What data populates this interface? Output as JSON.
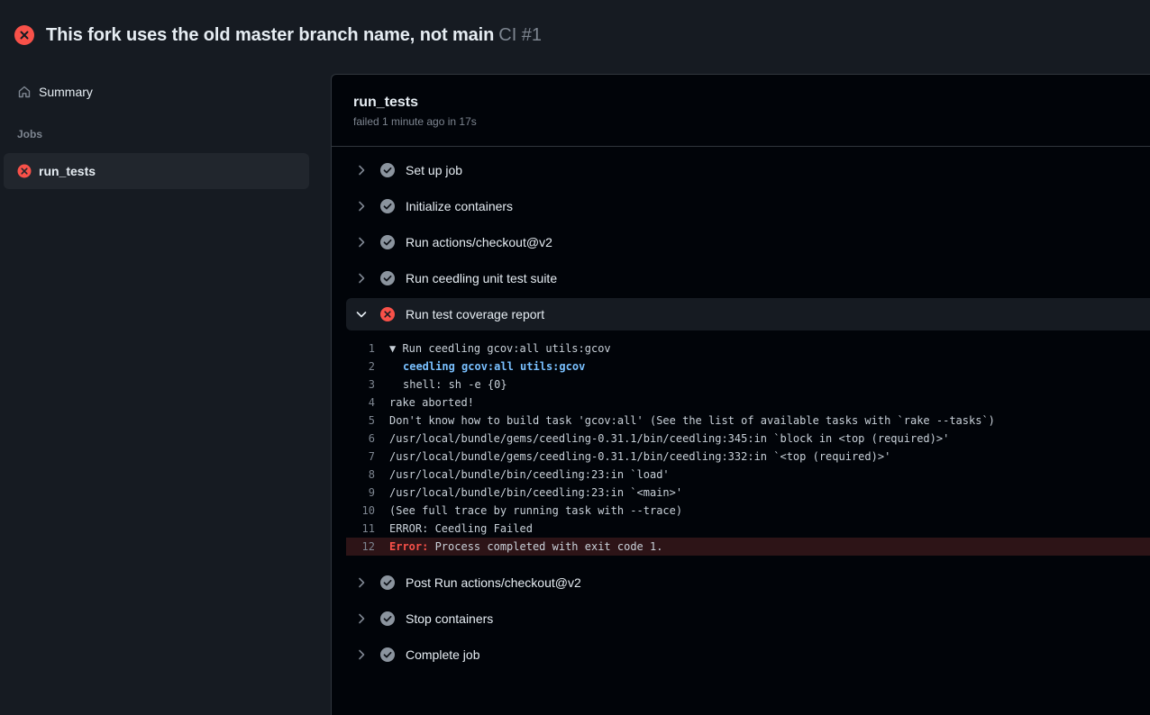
{
  "header": {
    "title": "This fork uses the old master branch name, not main",
    "workflow": "CI #1"
  },
  "sidebar": {
    "summary_label": "Summary",
    "jobs_heading": "Jobs",
    "jobs": [
      {
        "label": "run_tests",
        "status": "failed"
      }
    ]
  },
  "job": {
    "name": "run_tests",
    "subtitle": "failed 1 minute ago in 17s"
  },
  "steps_before": [
    {
      "label": "Set up job",
      "status": "success"
    },
    {
      "label": "Initialize containers",
      "status": "success"
    },
    {
      "label": "Run actions/checkout@v2",
      "status": "success"
    },
    {
      "label": "Run ceedling unit test suite",
      "status": "success"
    }
  ],
  "expanded_step": {
    "label": "Run test coverage report",
    "status": "failed",
    "log": [
      {
        "n": "1",
        "text": "▼ Run ceedling gcov:all utils:gcov"
      },
      {
        "n": "2",
        "text": "ceedling gcov:all utils:gcov"
      },
      {
        "n": "3",
        "text": "shell: sh -e {0}"
      },
      {
        "n": "4",
        "text": "rake aborted!"
      },
      {
        "n": "5",
        "text": "Don't know how to build task 'gcov:all' (See the list of available tasks with `rake --tasks`)"
      },
      {
        "n": "6",
        "text": "/usr/local/bundle/gems/ceedling-0.31.1/bin/ceedling:345:in `block in <top (required)>'"
      },
      {
        "n": "7",
        "text": "/usr/local/bundle/gems/ceedling-0.31.1/bin/ceedling:332:in `<top (required)>'"
      },
      {
        "n": "8",
        "text": "/usr/local/bundle/bin/ceedling:23:in `load'"
      },
      {
        "n": "9",
        "text": "/usr/local/bundle/bin/ceedling:23:in `<main>'"
      },
      {
        "n": "10",
        "text": "(See full trace by running task with --trace)"
      },
      {
        "n": "11",
        "text": "ERROR: Ceedling Failed"
      },
      {
        "n": "12",
        "err_label": "Error:",
        "text": " Process completed with exit code 1."
      }
    ]
  },
  "steps_after": [
    {
      "label": "Post Run actions/checkout@v2",
      "status": "success"
    },
    {
      "label": "Stop containers",
      "status": "success"
    },
    {
      "label": "Complete job",
      "status": "success"
    }
  ],
  "colors": {
    "failed": "#f85149",
    "success_icon": "#8b949e",
    "background": "#161b22",
    "panel": "#010409"
  }
}
